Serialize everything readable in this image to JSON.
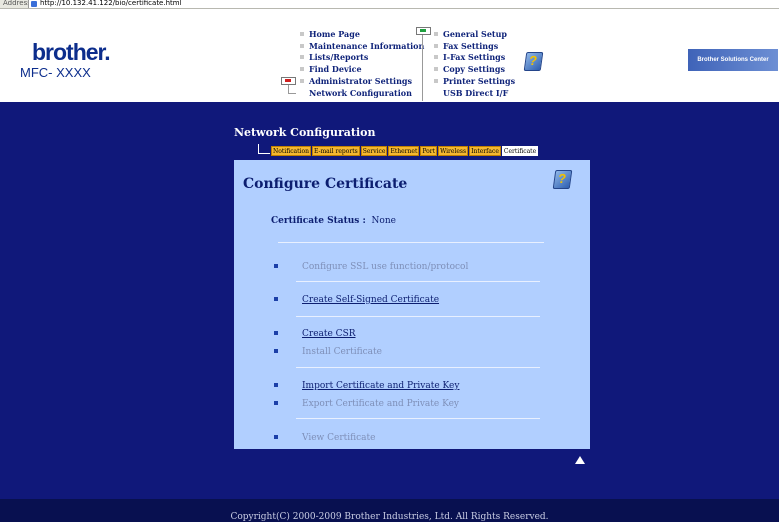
{
  "browser": {
    "address_label": "Address",
    "url": "http://10.132.41.122/bio/certificate.html"
  },
  "header": {
    "logo": "brother",
    "model": "MFC- XXXX",
    "solutions_center": "Brother Solutions Center",
    "menu_left": [
      "Home Page",
      "Maintenance Information",
      "Lists/Reports",
      "Find Device",
      "Administrator Settings",
      "Network Configuration"
    ],
    "menu_right": [
      "General Setup",
      "Fax Settings",
      "I-Fax Settings",
      "Copy Settings",
      "Printer Settings",
      "USB Direct I/F"
    ]
  },
  "section": {
    "title": "Network Configuration",
    "tabs": [
      "Notification",
      "E-mail reports",
      "Service",
      "Ethernet",
      "Port",
      "Wireless",
      "Interface",
      "Certificate"
    ],
    "active_tab": "Certificate"
  },
  "panel": {
    "title": "Configure Certificate",
    "status_label": "Certificate Status :",
    "status_value": "None",
    "items": [
      {
        "label": "Configure SSL use function/protocol",
        "enabled": false
      },
      {
        "label": "Create Self-Signed Certificate",
        "enabled": true
      },
      {
        "label": "Create CSR",
        "enabled": true
      },
      {
        "label": "Install Certificate",
        "enabled": false
      },
      {
        "label": "Import Certificate and Private Key",
        "enabled": true
      },
      {
        "label": "Export Certificate and Private Key",
        "enabled": false
      },
      {
        "label": "View Certificate",
        "enabled": false
      }
    ]
  },
  "footer": {
    "copyright": "Copyright(C) 2000-2009 Brother Industries, Ltd. All Rights Reserved."
  },
  "colors": {
    "background": "#10187a",
    "panel": "#b1cfff",
    "tab": "#f5b830",
    "brand": "#0c2d8c"
  },
  "icons": {
    "help": "help-question-icon",
    "top": "scroll-top-arrow-icon"
  }
}
